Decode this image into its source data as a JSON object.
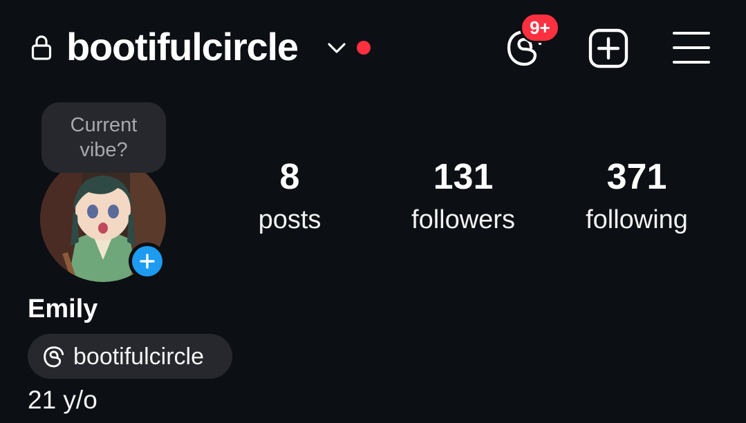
{
  "header": {
    "username": "bootifulcircle",
    "notification_badge": "9+",
    "icons": [
      "lock-icon",
      "chevron-down-icon",
      "threads-icon",
      "add-square-icon",
      "hamburger-menu-icon"
    ]
  },
  "profile": {
    "note_text": "Current vibe?",
    "display_name": "Emily",
    "threads_handle": "bootifulcircle",
    "bio": "21 y/o"
  },
  "stats": {
    "posts": {
      "count": "8",
      "label": "posts"
    },
    "followers": {
      "count": "131",
      "label": "followers"
    },
    "following": {
      "count": "371",
      "label": "following"
    }
  },
  "colors": {
    "background": "#0c0f14",
    "accent_blue": "#1d9bf0",
    "notification_red": "#ff3040",
    "chip_background": "#26282d"
  }
}
